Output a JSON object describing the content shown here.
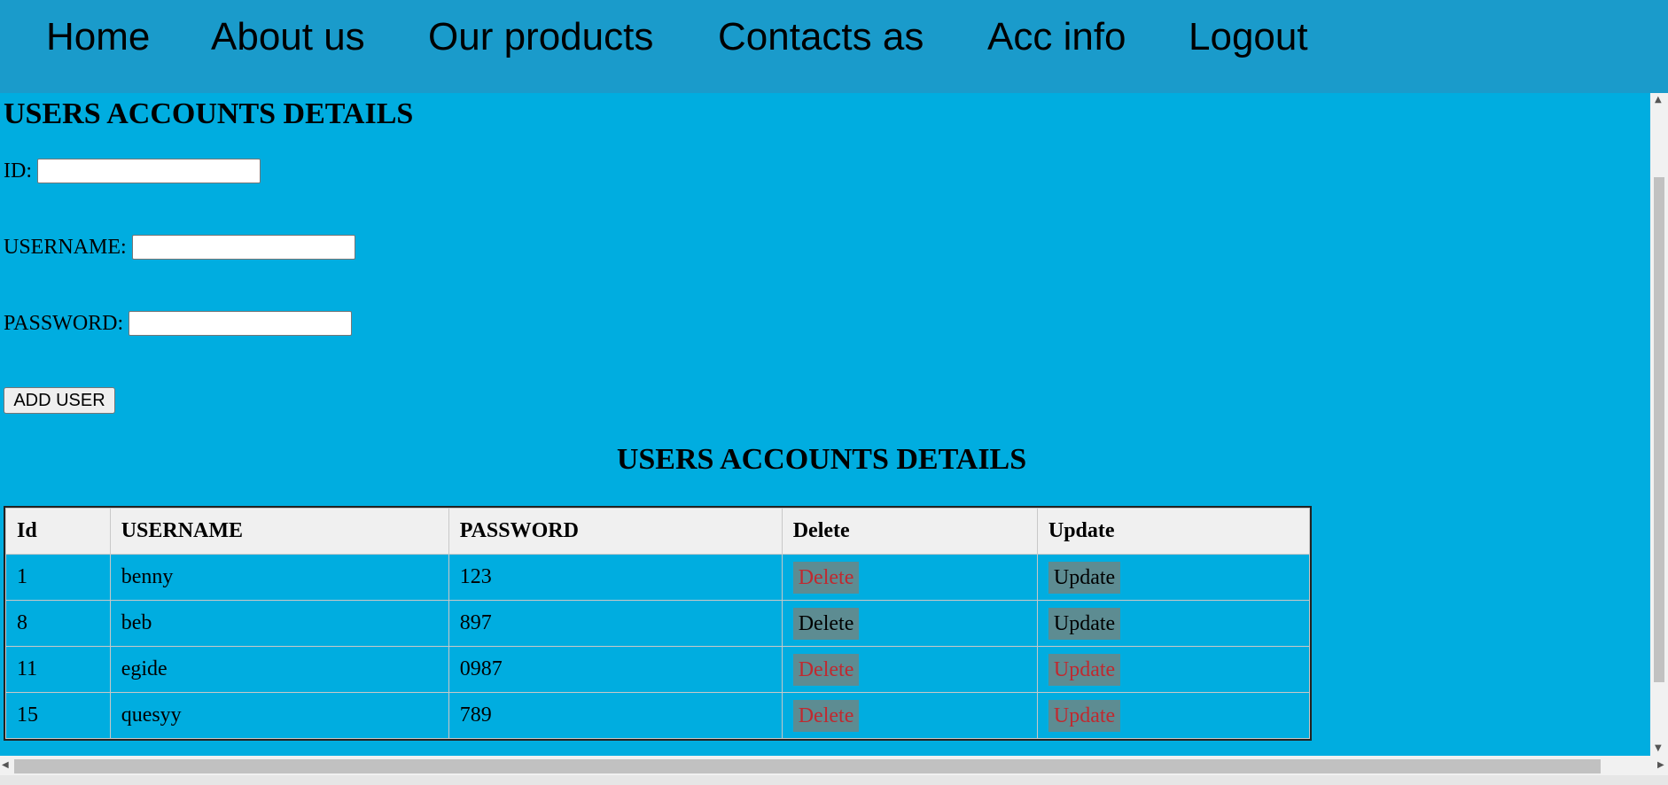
{
  "nav": {
    "items": [
      "Home",
      "About us",
      "Our products",
      "Contacts as",
      "Acc info",
      "Logout"
    ]
  },
  "form": {
    "title": "USERS ACCOUNTS DETAILS",
    "id_label": "ID:",
    "username_label": "USERNAME:",
    "password_label": "PASSWORD:",
    "id_value": "",
    "username_value": "",
    "password_value": "",
    "add_button": "ADD USER"
  },
  "table": {
    "title": "USERS ACCOUNTS DETAILS",
    "headers": [
      "Id",
      "USERNAME",
      "PASSWORD",
      "Delete",
      "Update"
    ],
    "rows": [
      {
        "id": "1",
        "username": "benny",
        "password": "123",
        "delete": "Delete",
        "update": "Update",
        "delete_color": "red",
        "update_color": "black"
      },
      {
        "id": "8",
        "username": "beb",
        "password": "897",
        "delete": "Delete",
        "update": "Update",
        "delete_color": "black",
        "update_color": "black"
      },
      {
        "id": "11",
        "username": "egide",
        "password": "0987",
        "delete": "Delete",
        "update": "Update",
        "delete_color": "red",
        "update_color": "red"
      },
      {
        "id": "15",
        "username": "quesyy",
        "password": "789",
        "delete": "Delete",
        "update": "Update",
        "delete_color": "red",
        "update_color": "red"
      }
    ]
  },
  "colors": {
    "page_bg": "#00ade0",
    "nav_bg": "#1a9bcb",
    "header_row_bg": "#f0f0f0",
    "cell_button_bg": "#5d8c92",
    "link_red": "#c0292f"
  }
}
